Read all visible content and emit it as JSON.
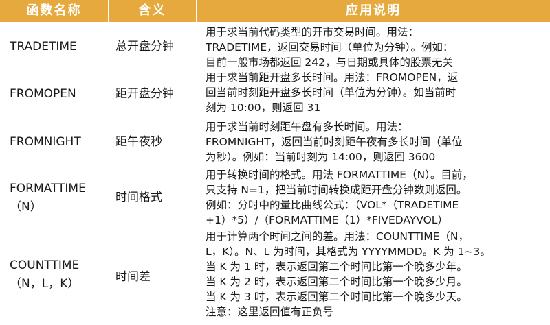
{
  "header": {
    "col_name": "函数名称",
    "col_meaning": "含义",
    "col_desc": "应用说明"
  },
  "rows": [
    {
      "name": "TRADETIME",
      "meaning": "总开盘分钟",
      "desc": [
        "用于求当前代码类型的开市交易时间。用法：",
        "TRADETIME，返回交易时间（单位为分钟）。例如：",
        "目前一般市场都返回 242，与日期或具体的股票无关"
      ]
    },
    {
      "name": "FROMOPEN",
      "meaning": "距开盘分钟",
      "desc": [
        "用于求当前距开盘多长时间。用法：FROMOPEN，返",
        "回当前时刻距开盘多长时间（单位为分钟）。如当前时",
        "刻为 10:00，则返回 31"
      ]
    },
    {
      "name": "FROMNIGHT",
      "meaning": "距午夜秒",
      "desc": [
        "用于求当前时刻距午盘有多长时间。用法：",
        "FROMNIGHT，返回当前时刻距午夜有多长时间（单位",
        "为秒）。例如：当前时刻为 14:00，则返回 3600"
      ]
    },
    {
      "name_lines": [
        "FORMATTIME",
        "（N）"
      ],
      "meaning": "时间格式",
      "desc": [
        "用于转换时间的格式。用法 FORMATTIME（N）。目前，",
        "只支持 N=1，把当前时间转换成距开盘分钟数则返回。",
        "例如：分时中的量比曲线公式：（VOL*（TRADETIME",
        "+1）*5）/（FORMATTIME（1）*FIVEDAYVOL）"
      ]
    },
    {
      "name_lines": [
        "COUNTTIME",
        "（N，L，K）"
      ],
      "meaning": "时间差",
      "desc": [
        "用于计算两个时间之间的差。用法：COUNTTIME（N，",
        "L，K）。N、L 为时间，其格式为 YYYYMMDD。K 为 1~3。",
        "当 K 为 1 时，表示返回第二个时间比第一个晚多少年。",
        "当 K 为 2 时，表示返回第二个时间比第一个晚多少月。",
        "当 K 为 3 时，表示返回第二个时间比第一个晚多少天。",
        "注意：这里返回值有正负号"
      ]
    }
  ]
}
